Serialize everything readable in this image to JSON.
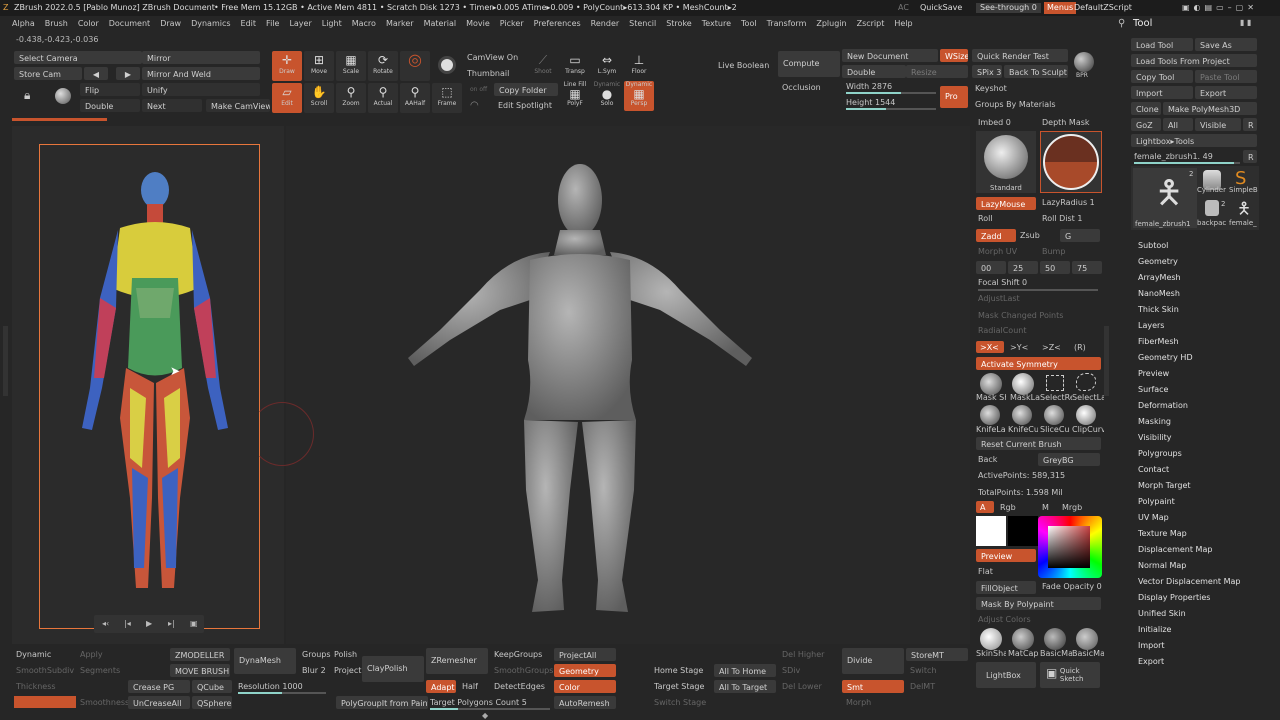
{
  "titlebar": {
    "title": "ZBrush 2022.0.5 [Pablo Munoz]   ZBrush Document",
    "stats": "• Free Mem 15.12GB • Active Mem 4811 • Scratch Disk 1273 • Timer▸0.005 ATime▸0.009 • PolyCount▸613.304 KP • MeshCount▸2",
    "ac": "AC",
    "quicksave": "QuickSave",
    "seethrough": "See-through  0",
    "menus": "Menus",
    "script": "DefaultZScript"
  },
  "menubar": [
    "Alpha",
    "Brush",
    "Color",
    "Document",
    "Draw",
    "Dynamics",
    "Edit",
    "File",
    "Layer",
    "Light",
    "Macro",
    "Marker",
    "Material",
    "Movie",
    "Picker",
    "Preferences",
    "Render",
    "Stencil",
    "Stroke",
    "Texture",
    "Tool",
    "Transform",
    "Zplugin",
    "Zscript",
    "Help"
  ],
  "coords": "-0.438,-0.423,-0.036",
  "toolbar": {
    "select_camera": "Select Camera",
    "mirror": "Mirror",
    "store_cam": "Store Cam",
    "mirror_weld": "Mirror And Weld",
    "flip": "Flip",
    "unify": "Unify",
    "double": "Double",
    "next": "Next",
    "make_camview": "Make CamView",
    "draw": "Draw",
    "move": "Move",
    "scale": "Scale",
    "rotate": "Rotate",
    "edit": "Edit",
    "scroll": "Scroll",
    "zoom": "Zoom",
    "actual": "Actual",
    "aahalf": "AAHalf",
    "frame": "Frame",
    "camview_on": "CamView On",
    "thumbnail": "Thumbnail",
    "copy_folder": "Copy Folder",
    "edit_spotlight": "Edit Spotlight",
    "shoot": "Shoot",
    "transp": "Transp",
    "lsym": "L.Sym",
    "floor": "Floor",
    "line_fill": "Line Fill",
    "polyf": "PolyF",
    "solo": "Solo",
    "dynamic": "Dynamic",
    "persp": "Persp",
    "live_boolean": "Live Boolean",
    "compute": "Compute",
    "occlusion": "Occlusion",
    "new_document": "New Document",
    "wsize": "WSize",
    "double2": "Double",
    "resize": "Resize",
    "width": "Width 2876",
    "height": "Height 1544",
    "pro": "Pro",
    "quick_render_test": "Quick Render Test",
    "spix": "SPix 3",
    "back_to_sculpt": "Back To Sculpt",
    "bpr": "BPR",
    "keyshot": "Keyshot",
    "groups_by_materials": "Groups By Materials"
  },
  "playback": [
    "◂‹",
    "|◂",
    "▶",
    "▸|",
    "▣"
  ],
  "brushpanel": {
    "imbed": "Imbed 0",
    "depth_mask": "Depth Mask",
    "standard": "Standard",
    "lazymouse": "LazyMouse",
    "lazyradius": "LazyRadius 1",
    "roll": "Roll",
    "roll_dist": "Roll Dist 1",
    "zadd": "Zadd",
    "zsub": "Zsub",
    "g": "G",
    "morph_uv": "Morph UV",
    "bump": "Bump",
    "nums": [
      "00",
      "25",
      "50",
      "75"
    ],
    "focal_shift": "Focal Shift 0",
    "adjust_last": "AdjustLast",
    "mask_changed_points": "Mask Changed Points",
    "radial_count": "RadialCount",
    "sym_x": ">X<",
    "sym_y": ">Y<",
    "sym_z": ">Z<",
    "sym_r": "(R)",
    "activate_symmetry": "Activate Symmetry",
    "brush_icons": [
      "Mask Sh",
      "MaskLa",
      "SelectRe",
      "SelectLa",
      "KnifeLa",
      "KnifeCu",
      "SliceCu",
      "ClipCurv"
    ],
    "reset_current_brush": "Reset Current Brush",
    "back": "Back",
    "greybg": "GreyBG",
    "active_points": "ActivePoints: 589,315",
    "total_points": "TotalPoints: 1.598 Mil",
    "a": "A",
    "rgb": "Rgb",
    "m": "M",
    "mrgb": "Mrgb",
    "preview": "Preview",
    "flat": "Flat",
    "fillobject": "FillObject",
    "fade_opacity": "Fade Opacity 0",
    "mask_by_polypaint": "Mask By Polypaint",
    "adjust_colors": "Adjust Colors",
    "materials": [
      "SkinSha",
      "MatCap",
      "BasicMa",
      "BasicMa"
    ],
    "lightbox": "LightBox",
    "quick_sketch": "Quick Sketch"
  },
  "tool": {
    "header": "Tool",
    "load_tool": "Load Tool",
    "save_as": "Save As",
    "load_from_project": "Load Tools From Project",
    "copy_tool": "Copy Tool",
    "paste_tool": "Paste Tool",
    "import": "Import",
    "export": "Export",
    "clone": "Clone",
    "make_polymesh": "Make PolyMesh3D",
    "goz": "GoZ",
    "all": "All",
    "visible": "Visible",
    "r": "R",
    "lightbox_tools": "Lightbox▸Tools",
    "current": "female_zbrush1. 49",
    "r2": "R",
    "thumbs": [
      "female_zbrush1",
      "Cylinder",
      "SimpleB",
      "backpac",
      "female_"
    ],
    "thumb_counts": [
      "2",
      "2"
    ],
    "sections": [
      "Subtool",
      "Geometry",
      "ArrayMesh",
      "NanoMesh",
      "Thick Skin",
      "Layers",
      "FiberMesh",
      "Geometry HD",
      "Preview",
      "Surface",
      "Deformation",
      "Masking",
      "Visibility",
      "Polygroups",
      "Contact",
      "Morph Target",
      "Polypaint",
      "UV Map",
      "Texture Map",
      "Displacement Map",
      "Normal Map",
      "Vector Displacement Map",
      "Display Properties",
      "Unified Skin",
      "Initialize",
      "Import",
      "Export"
    ]
  },
  "bottom": {
    "dynamic": "Dynamic",
    "apply": "Apply",
    "zmodeller": "ZMODELLER",
    "dynamesh": "DynaMesh",
    "groups": "Groups",
    "polish": "Polish",
    "smoothsubdiv": "SmoothSubdiv",
    "segments": "Segments",
    "move_brush": "MOVE BRUSH",
    "blur": "Blur 2",
    "project": "Project",
    "claypolish": "ClayPolish",
    "thickness": "Thickness",
    "crease_pg": "Crease PG",
    "qcube": "QCube",
    "resolution": "Resolution 1000",
    "smoothness": "Smoothness",
    "uncrease_all": "UnCreaseAll",
    "qsphere": "QSphere",
    "polygroupit": "PolyGroupIt from Paint",
    "zremesher": "ZRemesher",
    "adapt": "Adapt",
    "half": "Half",
    "target_polygons": "Target Polygons Count 5",
    "keepgroups": "KeepGroups",
    "smoothgroups": "SmoothGroups",
    "detectedges": "DetectEdges",
    "projectall": "ProjectAll",
    "geometry": "Geometry",
    "color": "Color",
    "autoremesh": "AutoRemesh",
    "home_stage": "Home Stage",
    "target_stage": "Target Stage",
    "switch_stage": "Switch Stage",
    "all_to_home": "All To Home",
    "all_to_target": "All To Target",
    "del_higher": "Del Higher",
    "sdiv": "SDiv",
    "del_lower": "Del Lower",
    "divide": "Divide",
    "smt": "Smt",
    "storemt": "StoreMT",
    "switch": "Switch",
    "delmt": "DelMT",
    "morph": "Morph"
  },
  "colors": {
    "accent": "#c8542d",
    "bg": "#262626",
    "panel": "#3a3a3a",
    "slider": "#8fd3c9"
  }
}
